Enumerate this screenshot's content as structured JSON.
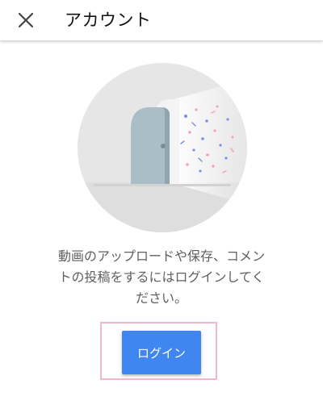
{
  "header": {
    "title": "アカウント",
    "close_icon": "close-icon"
  },
  "main": {
    "illustration": "door-confetti-illustration",
    "message_lines": [
      "動画のアップロードや保存、コメン",
      "トの投稿をするにはログインしてく",
      "ださい。"
    ],
    "login_label": "ログイン"
  },
  "colors": {
    "accent": "#3f86f1",
    "highlight_border": "#f2b5cf",
    "text_secondary": "#606060"
  }
}
